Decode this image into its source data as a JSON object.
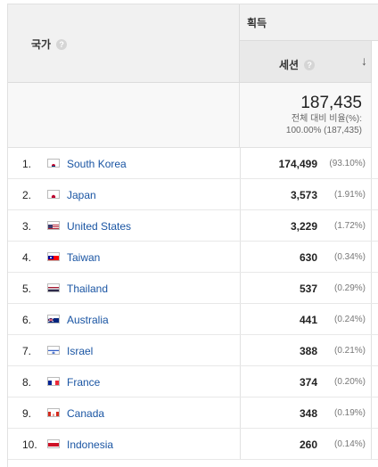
{
  "header": {
    "country_label": "국가",
    "acquisition_label": "획득",
    "sessions_label": "세션",
    "help_glyph": "?",
    "sort_glyph": "↓"
  },
  "totals": {
    "value": "187,435",
    "pct_label": "전체 대비 비율(%):",
    "pct_value": "100.00% (187,435)"
  },
  "rows": [
    {
      "idx": "1.",
      "country": "South Korea",
      "sessions": "174,499",
      "pct": "(93.10%)",
      "flag": "kr"
    },
    {
      "idx": "2.",
      "country": "Japan",
      "sessions": "3,573",
      "pct": "(1.91%)",
      "flag": "jp"
    },
    {
      "idx": "3.",
      "country": "United States",
      "sessions": "3,229",
      "pct": "(1.72%)",
      "flag": "us"
    },
    {
      "idx": "4.",
      "country": "Taiwan",
      "sessions": "630",
      "pct": "(0.34%)",
      "flag": "tw"
    },
    {
      "idx": "5.",
      "country": "Thailand",
      "sessions": "537",
      "pct": "(0.29%)",
      "flag": "th"
    },
    {
      "idx": "6.",
      "country": "Australia",
      "sessions": "441",
      "pct": "(0.24%)",
      "flag": "au"
    },
    {
      "idx": "7.",
      "country": "Israel",
      "sessions": "388",
      "pct": "(0.21%)",
      "flag": "il"
    },
    {
      "idx": "8.",
      "country": "France",
      "sessions": "374",
      "pct": "(0.20%)",
      "flag": "fr"
    },
    {
      "idx": "9.",
      "country": "Canada",
      "sessions": "348",
      "pct": "(0.19%)",
      "flag": "ca"
    },
    {
      "idx": "10.",
      "country": "Indonesia",
      "sessions": "260",
      "pct": "(0.14%)",
      "flag": "id"
    }
  ]
}
